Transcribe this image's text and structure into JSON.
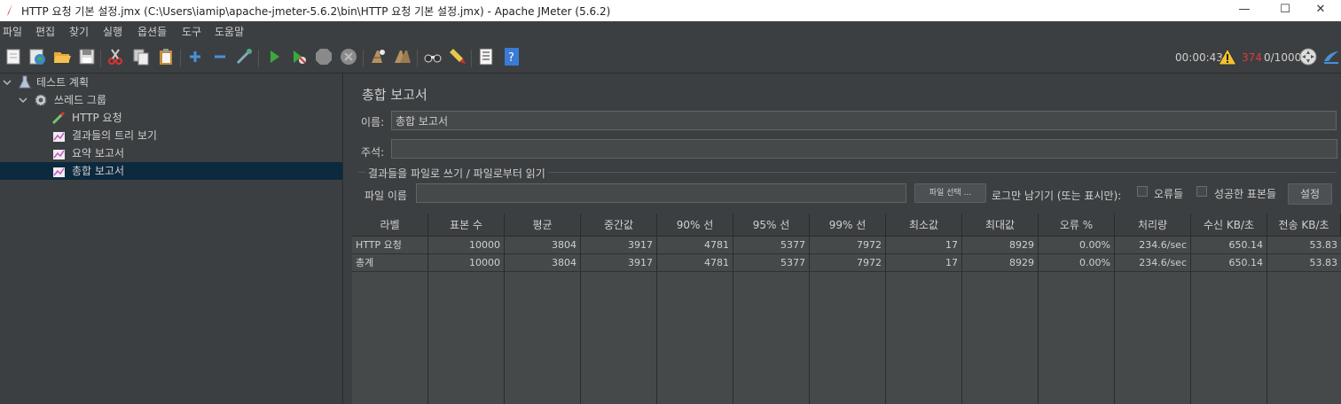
{
  "window": {
    "title": "HTTP 요청 기본 설정.jmx (C:\\Users\\iamip\\apache-jmeter-5.6.2\\bin\\HTTP 요청 기본 설정.jmx) - Apache JMeter (5.6.2)",
    "minimize": "—",
    "maximize": "☐",
    "close": "✕"
  },
  "menu": [
    "파일",
    "편집",
    "찾기",
    "실행",
    "옵션들",
    "도구",
    "도움말"
  ],
  "toolbar": {
    "elapsed": "00:00:43",
    "warning_count": "374",
    "threads": "0/1000"
  },
  "tree": {
    "items": [
      {
        "label": "테스트 계획",
        "icon": "flask-icon"
      },
      {
        "label": "쓰레드 그룹",
        "icon": "gear-icon"
      },
      {
        "label": "HTTP 요청",
        "icon": "pipette-icon"
      },
      {
        "label": "결과들의 트리 보기",
        "icon": "graph-icon"
      },
      {
        "label": "요약 보고서",
        "icon": "graph-icon"
      },
      {
        "label": "총합 보고서",
        "icon": "graph-icon"
      }
    ]
  },
  "panel": {
    "heading": "총합 보고서",
    "name_label": "이름:",
    "name_value": "총합 보고서",
    "comment_label": "주석:",
    "comment_value": "",
    "group_title": "결과들을 파일로 쓰기 / 파일로부터 읽기",
    "filename_label": "파일 이름",
    "filename_value": "",
    "browse_button": "파일 선택 ...",
    "log_only_label": "로그만 남기기 (또는 표시만):",
    "errors_label": "오류들",
    "success_label": "성공한 표본들",
    "settings_button": "설정"
  },
  "table": {
    "columns": [
      "라벨",
      "표본 수",
      "평균",
      "중간값",
      "90% 선",
      "95% 선",
      "99% 선",
      "최소값",
      "최대값",
      "오류 %",
      "처리량",
      "수신 KB/초",
      "전송 KB/초"
    ],
    "rows": [
      [
        "HTTP 요청",
        "10000",
        "3804",
        "3917",
        "4781",
        "5377",
        "7972",
        "17",
        "8929",
        "0.00%",
        "234.6/sec",
        "650.14",
        "53.83"
      ],
      [
        "총계",
        "10000",
        "3804",
        "3917",
        "4781",
        "5377",
        "7972",
        "17",
        "8929",
        "0.00%",
        "234.6/sec",
        "650.14",
        "53.83"
      ]
    ]
  },
  "colors": {
    "background": "#3c3f41",
    "selection": "#0d293e",
    "warning_count": "#e0393e",
    "run_green": "#3ca83c",
    "add_blue": "#4a90d9"
  }
}
